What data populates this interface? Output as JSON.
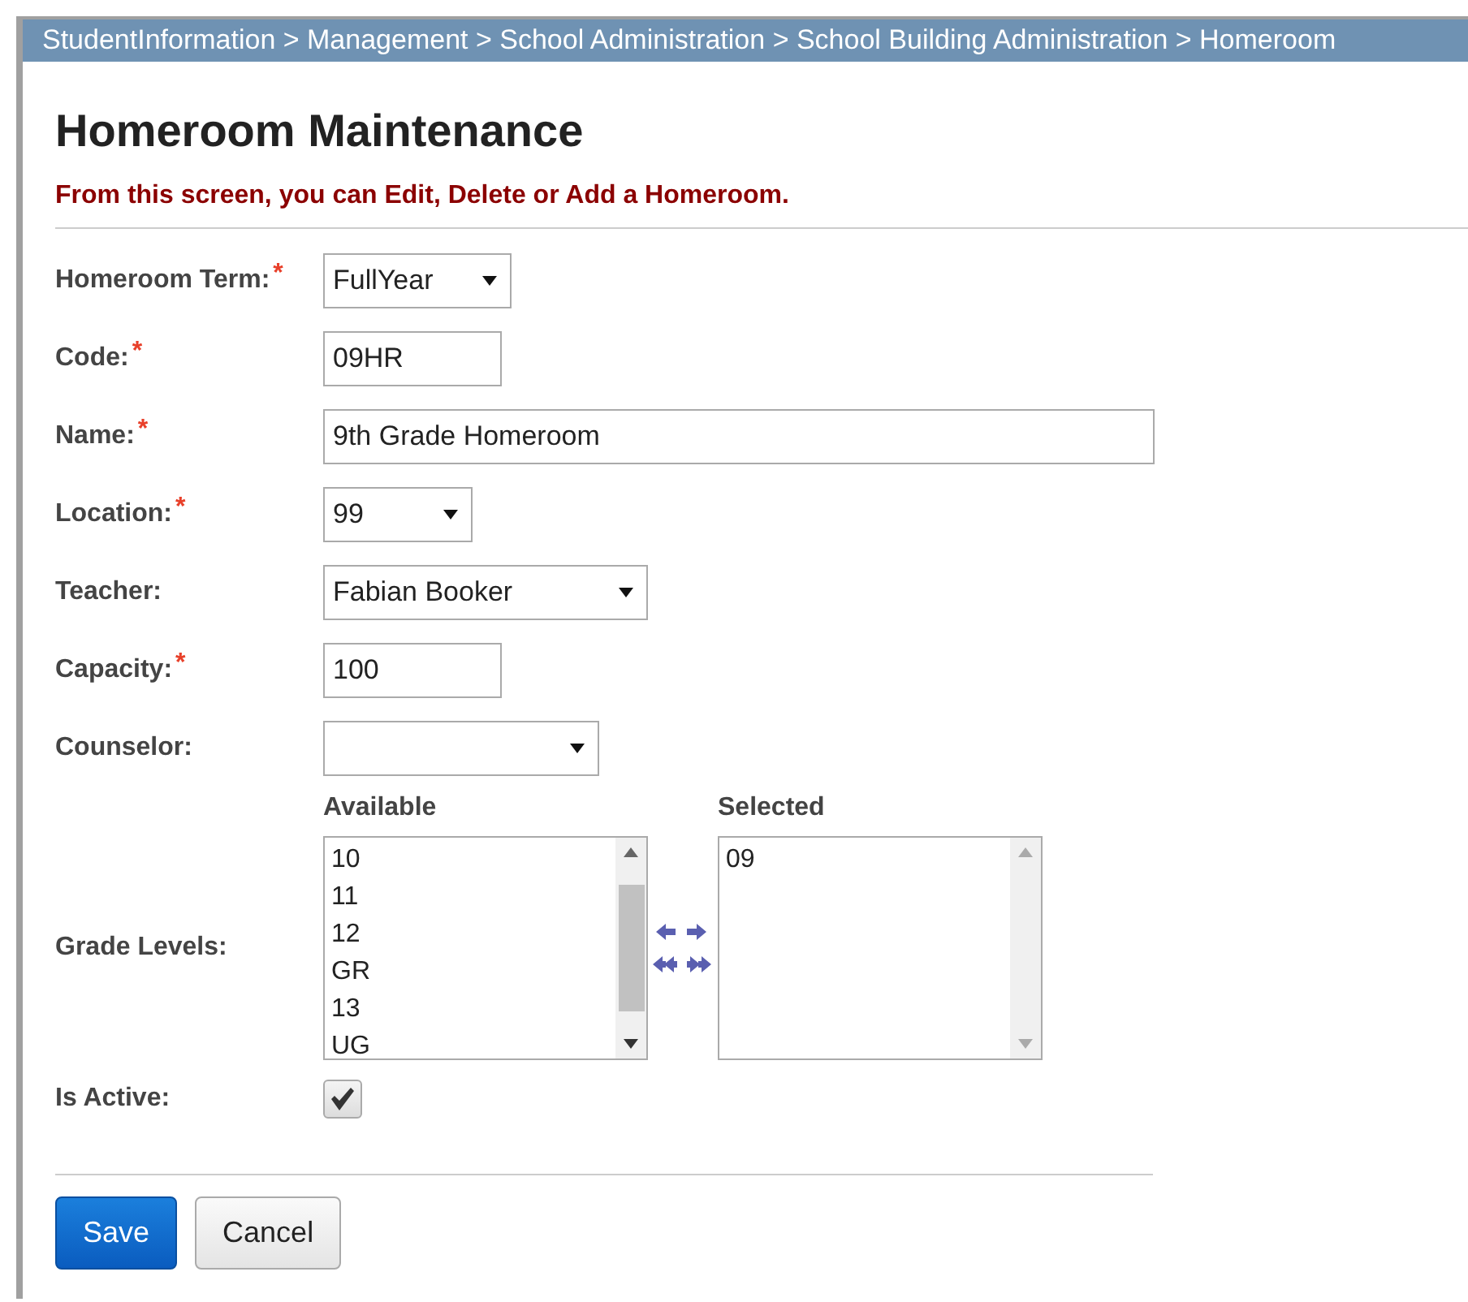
{
  "breadcrumb": "StudentInformation > Management > School Administration > School Building Administration > Homeroom",
  "title": "Homeroom Maintenance",
  "subtitle": "From this screen, you can Edit, Delete or Add a Homeroom.",
  "fields": [
    {
      "label": "Homeroom Term:",
      "required_mark": "*",
      "kind": "select",
      "value": "FullYear"
    },
    {
      "label": "Code:",
      "required_mark": "*",
      "kind": "text",
      "value": "09HR"
    },
    {
      "label": "Name:",
      "required_mark": "*",
      "kind": "text",
      "value": "9th Grade Homeroom"
    },
    {
      "label": "Location:",
      "required_mark": "*",
      "kind": "select",
      "value": "99"
    },
    {
      "label": "Teacher:",
      "kind": "select",
      "value": "Fabian Booker"
    },
    {
      "label": "Capacity:",
      "required_mark": "*",
      "kind": "text",
      "value": "100"
    },
    {
      "label": "Counselor:",
      "kind": "select"
    }
  ],
  "grade_levels": {
    "label": "Grade Levels:",
    "available_heading": "Available",
    "selected_heading": "Selected",
    "available": [
      "10",
      "11",
      "12",
      "GR",
      "13",
      "UG"
    ],
    "selected": [
      "09"
    ]
  },
  "is_active": {
    "label": "Is Active:",
    "checked": true
  },
  "buttons": [
    {
      "label": "Save",
      "kind": "primary"
    },
    {
      "label": "Cancel",
      "kind": "secondary"
    }
  ]
}
